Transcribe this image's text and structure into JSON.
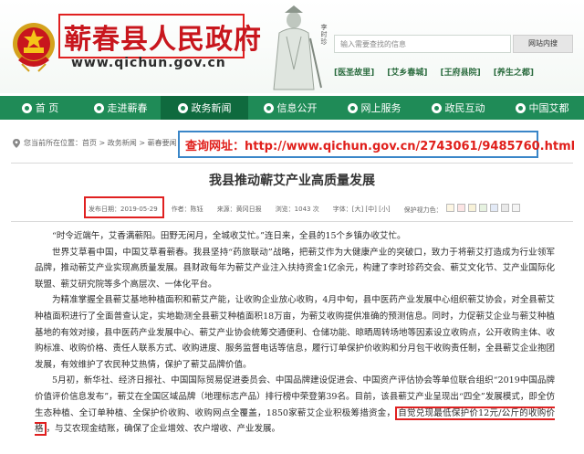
{
  "header": {
    "site_title": "蕲春县人民政府",
    "site_domain": "www.qichun.gov.cn",
    "portrait_caption": "李时珍",
    "search_placeholder": "输入需要查找的信息",
    "search_button": "网站内搜",
    "quick_links": [
      "[医圣故里]",
      "[艾乡春城]",
      "[王府县院]",
      "[养生之都]"
    ]
  },
  "nav": {
    "items": [
      {
        "label": "首 页",
        "active": false
      },
      {
        "label": "走进蕲春",
        "active": false
      },
      {
        "label": "政务新闻",
        "active": true
      },
      {
        "label": "信息公开",
        "active": false
      },
      {
        "label": "网上服务",
        "active": false
      },
      {
        "label": "政民互动",
        "active": false
      },
      {
        "label": "中国艾都",
        "active": false
      }
    ]
  },
  "breadcrumb": "您当前所在位置：首页 > 政务新闻 > 蕲春要闻",
  "query_url": "查询网址：http://www.qichun.gov.cn/2743061/9485760.html",
  "article": {
    "title": "我县推动蕲艾产业高质量发展",
    "meta": {
      "date": "发布日期：2019-05-29",
      "author": "作者：陈钰",
      "source": "来源：黄冈日报",
      "views": "浏览：1043 次",
      "font_size": "字体：[大] [中] [小]",
      "protect": "保护视力色："
    },
    "swatch_colors": [
      "#fdf6e3",
      "#fce4e4",
      "#f8f2d8",
      "#e6f2e0",
      "#e3eaf7",
      "#e9e9e9",
      "#f4f4f4"
    ],
    "paragraphs": [
      "“时令近端午，艾香满蕲阳。田野无闲月，全城收艾忙。”连日来，全县的15个乡镇办收艾忙。",
      "世界艾草看中国，中国艾草看蕲春。我县坚持“药旅联动”战略，把蕲艾作为大健康产业的突破口，致力于将蕲艾打造成为行业领军品牌，推动蕲艾产业实现高质量发展。县财政每年为蕲艾产业注入扶持资金1亿余元，构建了李时珍药交会、蕲艾文化节、艾产业国际化联盟、蕲艾研究院等多个高层次、一体化平台。",
      "为精准掌握全县蕲艾基地种植面积和蕲艾产能，让收购企业放心收购，4月中旬，县中医药产业发展中心组织蕲艾协会，对全县蕲艾种植面积进行了全面普查认定，实地勘测全县蕲艾种植面积18万亩，为蕲艾收购提供准确的预测信息。同时，力促蕲艾企业与蕲艾种植基地的有效对接，县中医药产业发展中心、蕲艾产业协会统筹交通便利、仓储功能、晾晒周转场地等因素设立收购点，公开收购主体、收购标准、收购价格、责任人联系方式、收购进度、服务监督电话等信息，履行订单保护价收购和分月包干收购责任制，全县蕲艾企业抱团发展，有效维护了农民种艾热情，保护了蕲艾品牌价值。"
    ],
    "p4_before": "5月初，新华社、经济日报社、中国国际贸易促进委员会、中国品牌建设促进会、中国资产评估协会等单位联合组织“2019中国品牌价值评价信息发布”，蕲艾在全国区域品牌（地理标志产品）排行榜中荣登第39名。目前，该县蕲艾产业呈现出“四全”发展模式，即全仿生态种植、全订单种植、全保护价收购、收购网点全覆盖，1850家蕲艾企业积极筹措资金，",
    "p4_highlight": "自觉兑现最低保护价12元/公斤的收购价格",
    "p4_after": "，与艾农现金结账，确保了企业增效、农户增收、产业发展。"
  }
}
